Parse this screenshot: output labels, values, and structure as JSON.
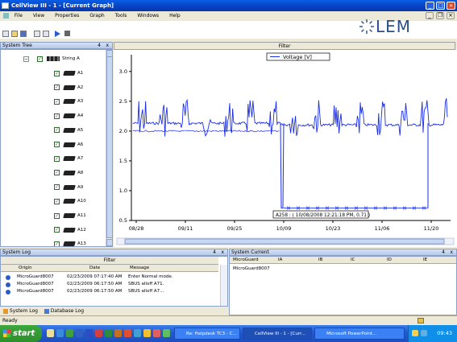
{
  "window": {
    "title": "CellView III - 1 - [Current Graph]"
  },
  "menu": [
    "File",
    "View",
    "Properties",
    "Graph",
    "Tools",
    "Windows",
    "Help"
  ],
  "brand": {
    "logo_text": "LEM",
    "color": "#2a4f8a"
  },
  "system_tree": {
    "title": "System Tree",
    "pin": "4",
    "close": "x",
    "root": {
      "label": "String A",
      "expander": "−"
    },
    "items": [
      "A1",
      "A2",
      "A3",
      "A4",
      "A5",
      "A6",
      "A7",
      "A8",
      "A9",
      "A10",
      "A11",
      "A12",
      "A13"
    ]
  },
  "graph": {
    "filter_label": "Filter",
    "legend": "Voltage [V]",
    "tooltip": "A258 : ( 10/08/2008 12:21:18 PM, 0.71 )",
    "series_color": "#1a2ee8"
  },
  "chart_data": {
    "type": "line",
    "series": [
      {
        "name": "Voltage [V]"
      }
    ],
    "x_ticks": [
      "08/28",
      "09/11",
      "09/25",
      "10/09",
      "10/23",
      "11/06",
      "11/20"
    ],
    "y_ticks": [
      "0.5",
      "1.0",
      "1.5",
      "2.0",
      "2.5",
      "3.0"
    ],
    "ylim": [
      0.5,
      3.2
    ],
    "base_value": 2.13,
    "spike_high": 2.55,
    "spike_low": 1.9,
    "dip_value": 0.71,
    "dip_start": "10/09",
    "dip_end": "11/20",
    "grid": false
  },
  "system_log": {
    "title": "System Log",
    "filter_label": "Filter",
    "columns": [
      "Origin",
      "Date",
      "Message"
    ],
    "rows": [
      {
        "origin": "MicroGuard8007",
        "date": "02/23/2009 07:17:40 AM",
        "message": "Enter Normal mode."
      },
      {
        "origin": "MicroGuard8007",
        "date": "02/23/2009 06:17:50 AM",
        "message": "SBUS alloff A71."
      },
      {
        "origin": "MicroGuard8007",
        "date": "02/23/2009 06:17:50 AM",
        "message": "SBUS alloff A7..."
      }
    ],
    "tabs": [
      "System Log",
      "Database Log"
    ]
  },
  "system_current": {
    "title": "System Current",
    "columns": [
      "MicroGuard",
      "IA",
      "IB",
      "IC",
      "ID",
      "IE"
    ],
    "rows": [
      [
        "MicroGuard8007",
        "",
        "",
        "",
        "",
        ""
      ]
    ]
  },
  "status": {
    "text": "Ready"
  },
  "taskbar": {
    "start_label": "start",
    "tasks": [
      "Re: Helpdesk TC3 - C...",
      "CellView III - 1 - [Curr...",
      "Microsoft PowerPoint..."
    ],
    "clock": "09:43"
  }
}
